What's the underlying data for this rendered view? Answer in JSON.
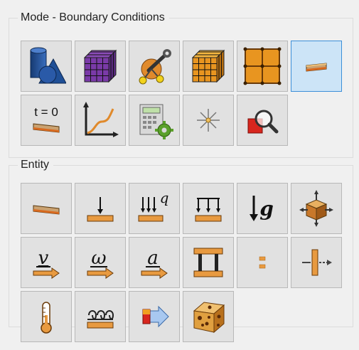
{
  "mode": {
    "title": "Mode - Boundary Conditions",
    "buttons": [
      {
        "icon": "geometry-icon"
      },
      {
        "icon": "mesh-cube-icon"
      },
      {
        "icon": "wrench-settings-icon"
      },
      {
        "icon": "orange-mesh-cube-icon"
      },
      {
        "icon": "grid-nodes-icon"
      },
      {
        "icon": "boundary-conditions-icon",
        "selected": true
      },
      {
        "icon": "initial-conditions-icon",
        "label": "t = 0"
      },
      {
        "icon": "curve-graph-icon"
      },
      {
        "icon": "calculator-gear-icon"
      },
      {
        "icon": "sparkle-icon"
      },
      {
        "icon": "magnifier-shape-icon"
      }
    ]
  },
  "entity": {
    "title": "Entity",
    "buttons": [
      {
        "icon": "beam-icon"
      },
      {
        "icon": "point-load-icon"
      },
      {
        "icon": "distributed-heat-icon",
        "label": "q"
      },
      {
        "icon": "distributed-load-icon"
      },
      {
        "icon": "gravity-icon",
        "label": "g"
      },
      {
        "icon": "body-force-icon"
      },
      {
        "icon": "velocity-icon",
        "label": "v"
      },
      {
        "icon": "angular-velocity-icon",
        "label": "ω"
      },
      {
        "icon": "acceleration-icon",
        "label": "a"
      },
      {
        "icon": "constraint-icon"
      },
      {
        "icon": "contact-icon"
      },
      {
        "icon": "symmetry-icon"
      },
      {
        "icon": "thermometer-icon"
      },
      {
        "icon": "convection-icon"
      },
      {
        "icon": "flow-arrow-icon"
      },
      {
        "icon": "porous-material-icon"
      }
    ]
  },
  "colors": {
    "accent": "#3c8fd8",
    "button_bg": "#e1e1e1",
    "selected_bg": "#cce4f7",
    "orange": "#e08a2c",
    "tan": "#caa271"
  }
}
